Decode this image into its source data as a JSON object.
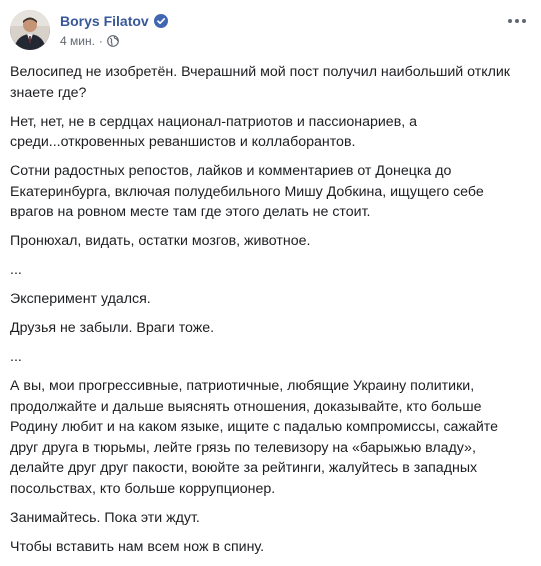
{
  "post": {
    "author": "Borys Filatov",
    "timestamp": "4 мин.",
    "meta_separator": "·",
    "icons": {
      "verified": "verified-badge-icon",
      "privacy": "globe-icon",
      "more": "more-options-icon"
    },
    "colors": {
      "author_link": "#385898",
      "verified": "#4267b2",
      "meta_text": "#616770",
      "body_text": "#1c1e21"
    },
    "paragraphs": [
      "Велосипед не изобретён. Вчерашний мой пост получил наибольший отклик знаете где?",
      "Нет, нет, не в сердцах национал-патриотов и пассионариев, а среди...откровенных реваншистов и коллаборантов.",
      "Сотни радостных репостов, лайков и комментариев от Донецка до Екатеринбурга, включая полудебильного Мишу Добкина, ищущего себе врагов на ровном месте там где этого делать не стоит.",
      "Пронюхал, видать, остатки мозгов, животное.",
      "...",
      "Эксперимент удался.",
      "Друзья не забыли. Враги тоже.",
      "...",
      "А вы, мои прогрессивные, патриотичные, любящие Украину политики, продолжайте и дальше выяснять отношения, доказывайте, кто больше Родину любит и на каком языке, ищите с падалью компромиссы, сажайте друг друга в тюрьмы, лейте грязь по телевизору на «барыжью владу», делайте друг друг пакости, воюйте за рейтинги, жалуйтесь в западных посольствах, кто больше коррупционер.",
      "Занимайтесь. Пока эти ждут.",
      "Чтобы вставить нам всем нож в спину."
    ]
  }
}
